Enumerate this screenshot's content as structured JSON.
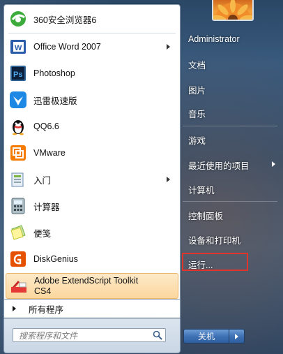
{
  "programs": [
    {
      "label": "360安全浏览器6",
      "icon": "browser-360-icon",
      "submenu": false
    },
    {
      "label": "Office Word 2007",
      "icon": "word-icon",
      "submenu": true
    },
    {
      "label": "Photoshop",
      "icon": "photoshop-icon",
      "submenu": false
    },
    {
      "label": "迅雷极速版",
      "icon": "thunder-icon",
      "submenu": false
    },
    {
      "label": "QQ6.6",
      "icon": "qq-penguin-icon",
      "submenu": false
    },
    {
      "label": "VMware",
      "icon": "vmware-icon",
      "submenu": false
    },
    {
      "label": "入门",
      "icon": "getting-started-icon",
      "submenu": true
    },
    {
      "label": "计算器",
      "icon": "calculator-icon",
      "submenu": false
    },
    {
      "label": "便笺",
      "icon": "sticky-notes-icon",
      "submenu": false
    },
    {
      "label": "DiskGenius",
      "icon": "diskgenius-icon",
      "submenu": false
    },
    {
      "label": "Adobe ExtendScript Toolkit",
      "label2": "CS4",
      "icon": "extendscript-icon",
      "submenu": false,
      "highlighted": true
    }
  ],
  "all_programs": "所有程序",
  "search": {
    "placeholder": "搜索程序和文件"
  },
  "right_panel": {
    "user": "Administrator",
    "documents": "文档",
    "pictures": "图片",
    "music": "音乐",
    "games": "游戏",
    "recent": "最近使用的项目",
    "computer": "计算机",
    "control_panel": "控制面板",
    "devices": "设备和打印机",
    "run": "运行..."
  },
  "shutdown": {
    "label": "关机"
  },
  "colors": {
    "highlight_border": "#e0342c",
    "accent": "#3f72b5"
  }
}
